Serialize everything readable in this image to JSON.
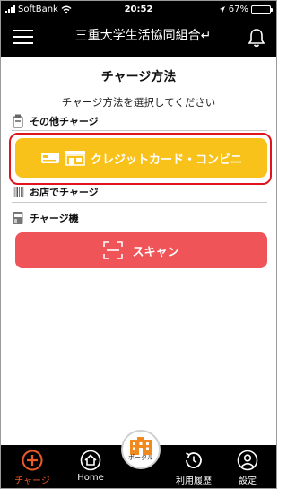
{
  "status_bar": {
    "carrier": "SoftBank",
    "time": "20:52",
    "battery_percent": "67%",
    "battery_level": 0.67
  },
  "header": {
    "title": "三重大学生活協同組合↵"
  },
  "page": {
    "title": "チャージ方法",
    "subtitle": "チャージ方法を選択してください"
  },
  "sections": {
    "other": {
      "label": "その他チャージ"
    },
    "store": {
      "label": "お店でチャージ"
    },
    "machine": {
      "label": "チャージ機"
    }
  },
  "buttons": {
    "credit_conveni": "クレジットカード・コンビニ",
    "scan": "スキャン"
  },
  "bottom_nav": {
    "charge": "チャージ",
    "home": "Home",
    "portal": "ポータル",
    "history": "利用履歴",
    "settings": "設定"
  },
  "colors": {
    "accent_yellow": "#f9c21b",
    "accent_red": "#ef5458",
    "highlight_outline": "#e0141e",
    "active_nav": "#f05a28"
  }
}
